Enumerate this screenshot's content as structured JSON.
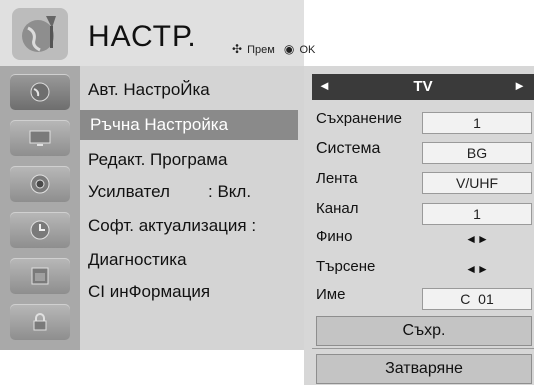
{
  "header": {
    "title": "НАСТР.",
    "hint_move": "Прем",
    "hint_ok": "OK",
    "icon": "settings-globe-icon"
  },
  "categories": [
    {
      "name": "setup-category",
      "icon": "globe-icon",
      "active": true
    },
    {
      "name": "picture-category",
      "icon": "tv-screen-icon",
      "active": false
    },
    {
      "name": "audio-category",
      "icon": "speaker-icon",
      "active": false
    },
    {
      "name": "time-category",
      "icon": "clock-icon",
      "active": false
    },
    {
      "name": "option-category",
      "icon": "calendar-icon",
      "active": false
    },
    {
      "name": "lock-category",
      "icon": "lock-icon",
      "active": false
    }
  ],
  "menu_items": [
    {
      "label": "Авт. НастроЙка"
    },
    {
      "label": "Ръчна Настройка",
      "selected": true
    },
    {
      "label": "Редакт. Програма"
    },
    {
      "label": "Усилвател",
      "value": ": Вкл."
    },
    {
      "label": "Софт. актуализация :"
    },
    {
      "label": "Диагностика"
    },
    {
      "label": "CI инФормация"
    }
  ],
  "manual_tuning": {
    "mode": "TV",
    "rows": [
      {
        "label": "Съхранение",
        "value": "1"
      },
      {
        "label": "Система",
        "value": "BG"
      },
      {
        "label": "Лента",
        "value": "V/UHF"
      },
      {
        "label": "Канал",
        "value": "1"
      },
      {
        "label": "Фино",
        "value": "◄►"
      },
      {
        "label": "Търсене",
        "value": "◄►"
      },
      {
        "label": "Име",
        "value": "C  01"
      }
    ],
    "store_button": "Съхр.",
    "close_button": "Затваряне"
  },
  "colors": {
    "panel_bg": "#d4d4d4",
    "iconbar_bg": "#a9a9a9",
    "selected_bg": "#8a8a8a",
    "subhead_bg": "#3a3a3a"
  }
}
